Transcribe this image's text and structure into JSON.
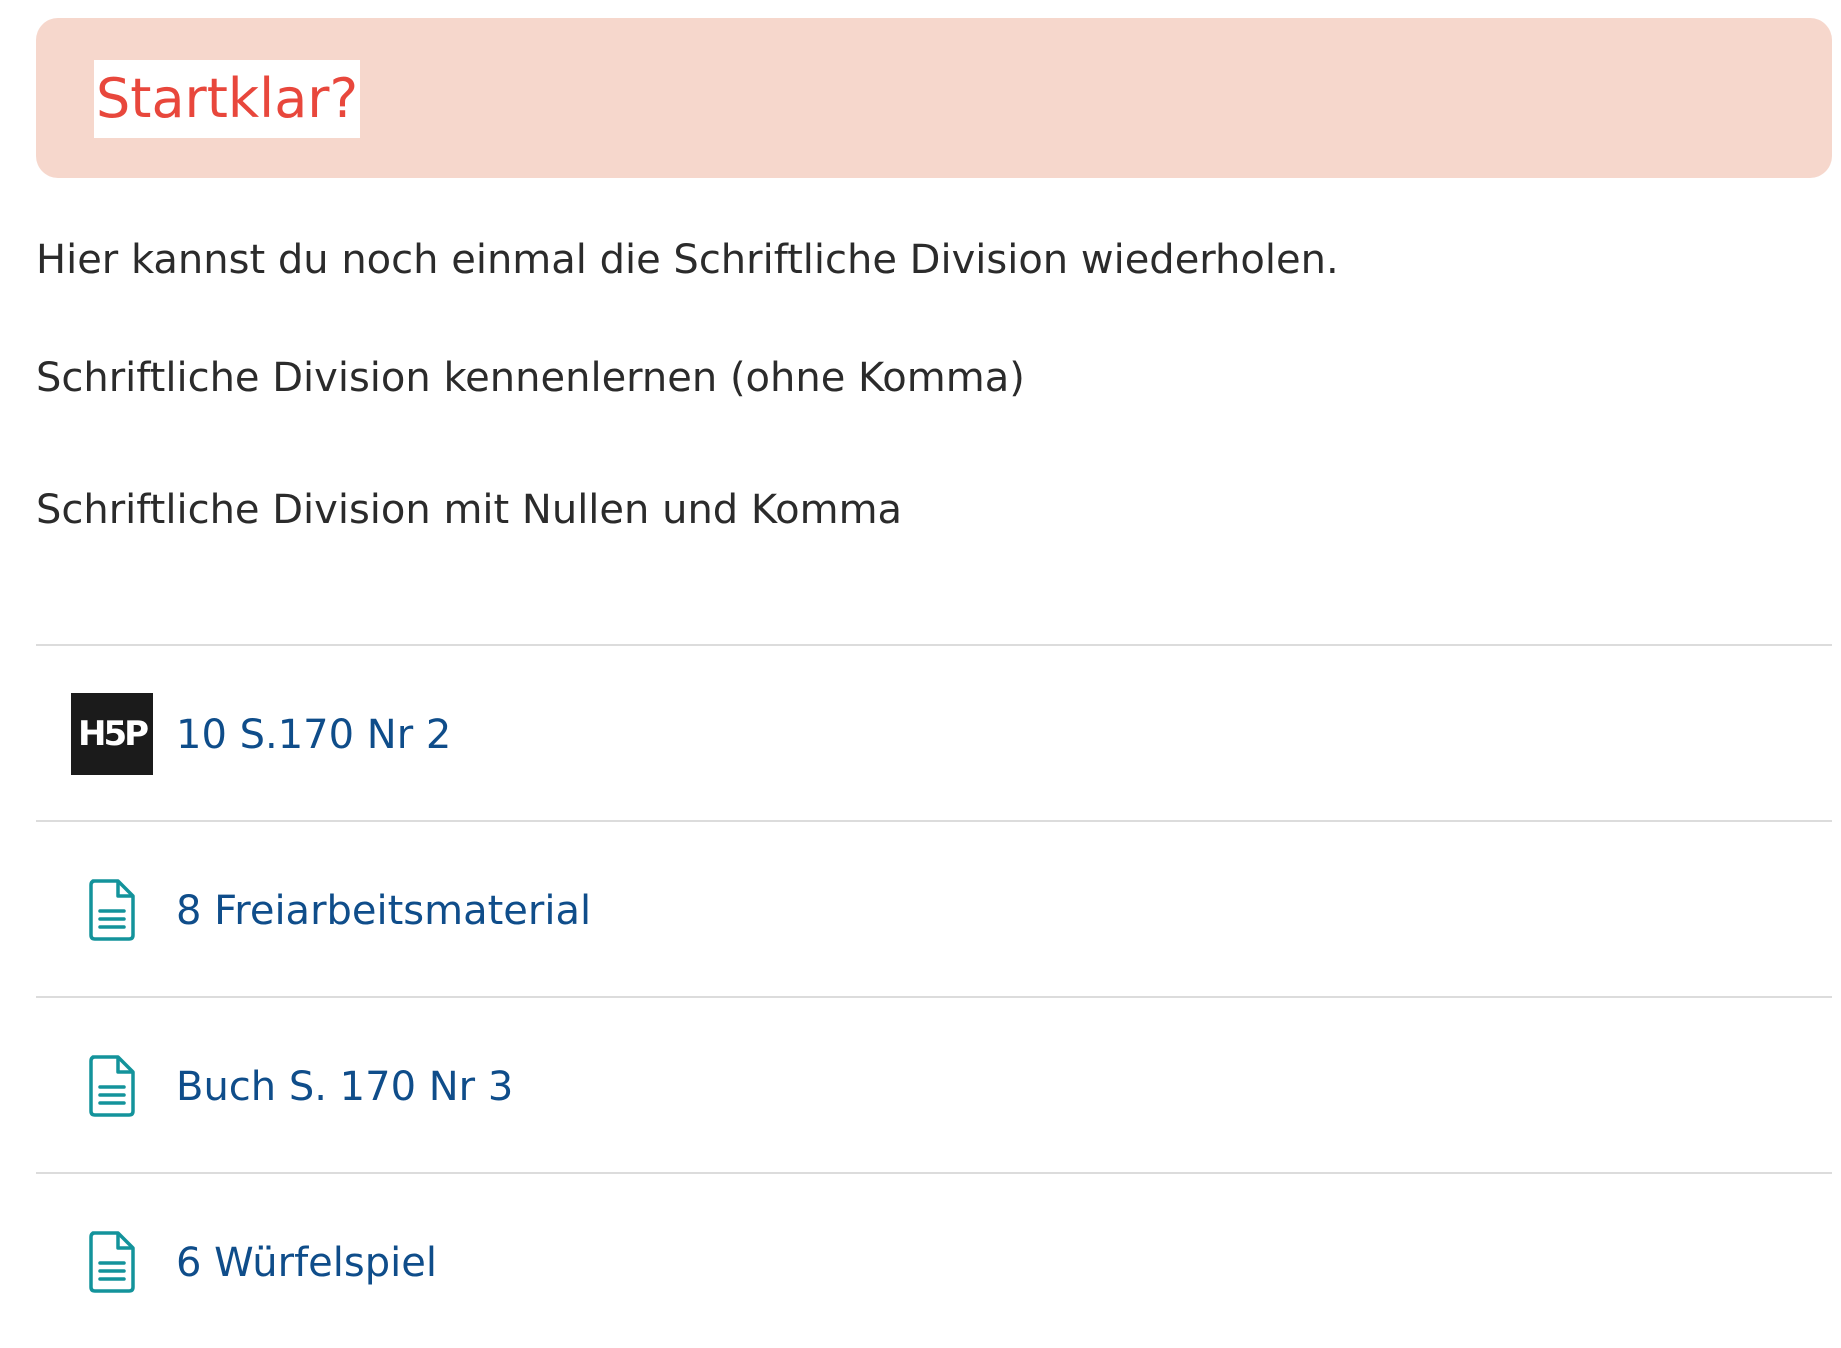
{
  "banner": {
    "title": "Startklar?"
  },
  "intro_text": "Hier kannst du noch einmal die Schriftliche Division wiederholen.",
  "links": [
    {
      "label": "Schriftliche Division kennenlernen (ohne Komma)"
    },
    {
      "label": "Schriftliche Division mit Nullen und Komma"
    }
  ],
  "activities": [
    {
      "label": "10 S.170 Nr 2",
      "icon": "h5p-icon",
      "icon_text": "H5P"
    },
    {
      "label": "8 Freiarbeitsmaterial",
      "icon": "document-icon"
    },
    {
      "label": "Buch S. 170 Nr 3",
      "icon": "document-icon"
    },
    {
      "label": "6 Würfelspiel",
      "icon": "document-icon"
    }
  ],
  "colors": {
    "banner_bg": "#f6d7cc",
    "banner_title": "#e8473c",
    "link": "#0f4d8a",
    "doc_icon": "#13939b",
    "divider": "#dcdcdc"
  }
}
